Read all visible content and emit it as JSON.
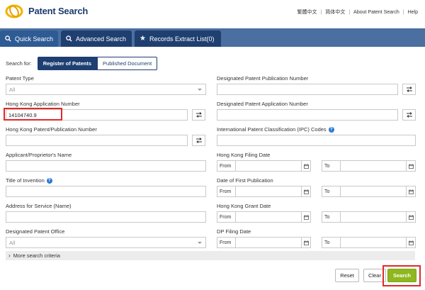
{
  "header": {
    "brand": "Patent Search",
    "links": [
      "繁體中文",
      "简体中文",
      "About Patent Search",
      "Help"
    ]
  },
  "nav": {
    "tabs": [
      {
        "label": "Quick Search",
        "icon": "search-icon",
        "active": true
      },
      {
        "label": "Advanced Search",
        "icon": "search-icon",
        "active": false
      },
      {
        "label": "Records Extract List(0)",
        "icon": "star-icon",
        "active": false
      }
    ]
  },
  "search_for": {
    "label": "Search for:",
    "options": [
      "Register of Patents",
      "Published Document"
    ],
    "selected": "Register of Patents"
  },
  "left_fields": {
    "patent_type": {
      "label": "Patent Type",
      "value": "All"
    },
    "hk_app_number": {
      "label": "Hong Kong Application Number",
      "value": "14104740.9"
    },
    "hk_patent_pub_number": {
      "label": "Hong Kong Patent/Publication Number",
      "value": ""
    },
    "applicant": {
      "label": "Applicant/Proprietor's Name",
      "value": ""
    },
    "title": {
      "label": "Title of Invention",
      "value": ""
    },
    "address": {
      "label": "Address for Service (Name)",
      "value": ""
    },
    "designated_office": {
      "label": "Designated Patent Office",
      "value": "All"
    }
  },
  "right_fields": {
    "dp_pub_number": {
      "label": "Designated Patent Publication Number",
      "value": ""
    },
    "dp_app_number": {
      "label": "Designated Patent Application Number",
      "value": ""
    },
    "ipc": {
      "label": "International Patent Classification (IPC) Codes",
      "value": ""
    },
    "hk_filing_date": {
      "label": "Hong Kong Filing Date"
    },
    "first_pub_date": {
      "label": "Date of First Publication"
    },
    "hk_grant_date": {
      "label": "Hong Kong Grant Date"
    },
    "dp_filing_date": {
      "label": "DP Filing Date"
    }
  },
  "date_labels": {
    "from": "From",
    "to": "To"
  },
  "more_criteria": "More search criteria",
  "buttons": {
    "reset": "Reset",
    "clear": "Clear",
    "search": "Search"
  },
  "colors": {
    "nav_bg": "#4a6fa0",
    "tab_active": "#2e5b93",
    "tab_inactive": "#1f3f70",
    "search_button": "#8fb71e",
    "highlight": "#e02a2a",
    "help_icon": "#2d7bd4"
  }
}
